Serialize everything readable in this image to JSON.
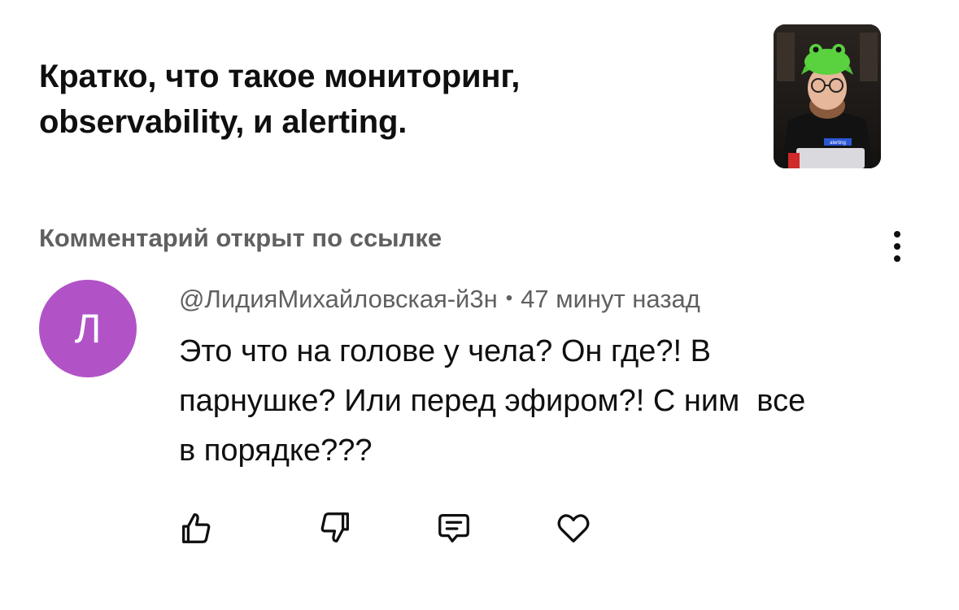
{
  "video": {
    "title": "Кратко, что такое мониторинг, observability, и alerting.",
    "thumbnail_icon": "video-thumbnail-image",
    "thumbnail_badge": "alerting"
  },
  "comments_section": {
    "label": "Комментарий открыт по ссылке",
    "menu_icon": "more-vertical-icon"
  },
  "comment": {
    "avatar_letter": "Л",
    "avatar_color": "#b153c7",
    "author": "@ЛидияМихайловская-й3н",
    "separator": "•",
    "time": "47 минут назад",
    "text": "Это что на голове у чела? Он где?! В\nпарнушке? Или перед эфиром?! С ним  все\nв порядке???"
  },
  "actions": [
    {
      "icon": "like-icon"
    },
    {
      "icon": "dislike-icon"
    },
    {
      "icon": "reply-icon"
    },
    {
      "icon": "heart-icon"
    }
  ]
}
